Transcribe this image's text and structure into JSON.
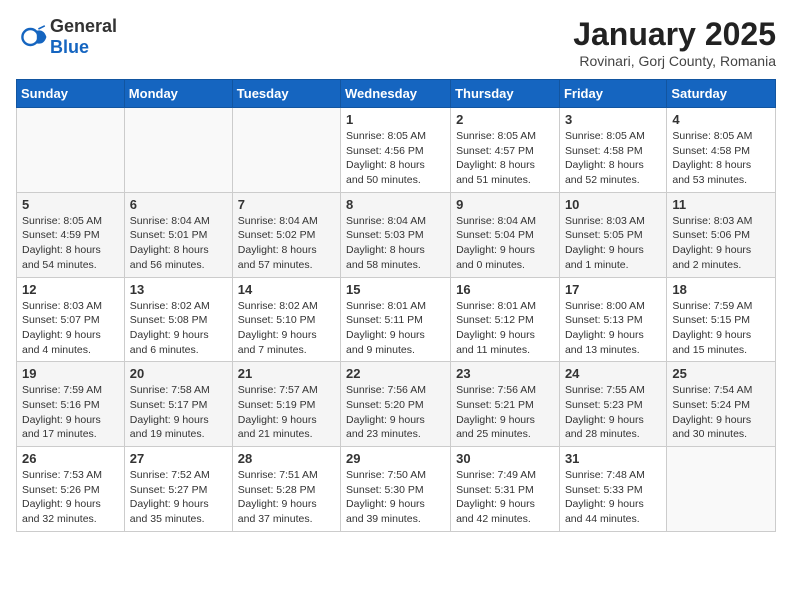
{
  "header": {
    "logo_general": "General",
    "logo_blue": "Blue",
    "title": "January 2025",
    "subtitle": "Rovinari, Gorj County, Romania"
  },
  "weekdays": [
    "Sunday",
    "Monday",
    "Tuesday",
    "Wednesday",
    "Thursday",
    "Friday",
    "Saturday"
  ],
  "weeks": [
    [
      {
        "day": "",
        "info": ""
      },
      {
        "day": "",
        "info": ""
      },
      {
        "day": "",
        "info": ""
      },
      {
        "day": "1",
        "info": "Sunrise: 8:05 AM\nSunset: 4:56 PM\nDaylight: 8 hours\nand 50 minutes."
      },
      {
        "day": "2",
        "info": "Sunrise: 8:05 AM\nSunset: 4:57 PM\nDaylight: 8 hours\nand 51 minutes."
      },
      {
        "day": "3",
        "info": "Sunrise: 8:05 AM\nSunset: 4:58 PM\nDaylight: 8 hours\nand 52 minutes."
      },
      {
        "day": "4",
        "info": "Sunrise: 8:05 AM\nSunset: 4:58 PM\nDaylight: 8 hours\nand 53 minutes."
      }
    ],
    [
      {
        "day": "5",
        "info": "Sunrise: 8:05 AM\nSunset: 4:59 PM\nDaylight: 8 hours\nand 54 minutes."
      },
      {
        "day": "6",
        "info": "Sunrise: 8:04 AM\nSunset: 5:01 PM\nDaylight: 8 hours\nand 56 minutes."
      },
      {
        "day": "7",
        "info": "Sunrise: 8:04 AM\nSunset: 5:02 PM\nDaylight: 8 hours\nand 57 minutes."
      },
      {
        "day": "8",
        "info": "Sunrise: 8:04 AM\nSunset: 5:03 PM\nDaylight: 8 hours\nand 58 minutes."
      },
      {
        "day": "9",
        "info": "Sunrise: 8:04 AM\nSunset: 5:04 PM\nDaylight: 9 hours\nand 0 minutes."
      },
      {
        "day": "10",
        "info": "Sunrise: 8:03 AM\nSunset: 5:05 PM\nDaylight: 9 hours\nand 1 minute."
      },
      {
        "day": "11",
        "info": "Sunrise: 8:03 AM\nSunset: 5:06 PM\nDaylight: 9 hours\nand 2 minutes."
      }
    ],
    [
      {
        "day": "12",
        "info": "Sunrise: 8:03 AM\nSunset: 5:07 PM\nDaylight: 9 hours\nand 4 minutes."
      },
      {
        "day": "13",
        "info": "Sunrise: 8:02 AM\nSunset: 5:08 PM\nDaylight: 9 hours\nand 6 minutes."
      },
      {
        "day": "14",
        "info": "Sunrise: 8:02 AM\nSunset: 5:10 PM\nDaylight: 9 hours\nand 7 minutes."
      },
      {
        "day": "15",
        "info": "Sunrise: 8:01 AM\nSunset: 5:11 PM\nDaylight: 9 hours\nand 9 minutes."
      },
      {
        "day": "16",
        "info": "Sunrise: 8:01 AM\nSunset: 5:12 PM\nDaylight: 9 hours\nand 11 minutes."
      },
      {
        "day": "17",
        "info": "Sunrise: 8:00 AM\nSunset: 5:13 PM\nDaylight: 9 hours\nand 13 minutes."
      },
      {
        "day": "18",
        "info": "Sunrise: 7:59 AM\nSunset: 5:15 PM\nDaylight: 9 hours\nand 15 minutes."
      }
    ],
    [
      {
        "day": "19",
        "info": "Sunrise: 7:59 AM\nSunset: 5:16 PM\nDaylight: 9 hours\nand 17 minutes."
      },
      {
        "day": "20",
        "info": "Sunrise: 7:58 AM\nSunset: 5:17 PM\nDaylight: 9 hours\nand 19 minutes."
      },
      {
        "day": "21",
        "info": "Sunrise: 7:57 AM\nSunset: 5:19 PM\nDaylight: 9 hours\nand 21 minutes."
      },
      {
        "day": "22",
        "info": "Sunrise: 7:56 AM\nSunset: 5:20 PM\nDaylight: 9 hours\nand 23 minutes."
      },
      {
        "day": "23",
        "info": "Sunrise: 7:56 AM\nSunset: 5:21 PM\nDaylight: 9 hours\nand 25 minutes."
      },
      {
        "day": "24",
        "info": "Sunrise: 7:55 AM\nSunset: 5:23 PM\nDaylight: 9 hours\nand 28 minutes."
      },
      {
        "day": "25",
        "info": "Sunrise: 7:54 AM\nSunset: 5:24 PM\nDaylight: 9 hours\nand 30 minutes."
      }
    ],
    [
      {
        "day": "26",
        "info": "Sunrise: 7:53 AM\nSunset: 5:26 PM\nDaylight: 9 hours\nand 32 minutes."
      },
      {
        "day": "27",
        "info": "Sunrise: 7:52 AM\nSunset: 5:27 PM\nDaylight: 9 hours\nand 35 minutes."
      },
      {
        "day": "28",
        "info": "Sunrise: 7:51 AM\nSunset: 5:28 PM\nDaylight: 9 hours\nand 37 minutes."
      },
      {
        "day": "29",
        "info": "Sunrise: 7:50 AM\nSunset: 5:30 PM\nDaylight: 9 hours\nand 39 minutes."
      },
      {
        "day": "30",
        "info": "Sunrise: 7:49 AM\nSunset: 5:31 PM\nDaylight: 9 hours\nand 42 minutes."
      },
      {
        "day": "31",
        "info": "Sunrise: 7:48 AM\nSunset: 5:33 PM\nDaylight: 9 hours\nand 44 minutes."
      },
      {
        "day": "",
        "info": ""
      }
    ]
  ]
}
